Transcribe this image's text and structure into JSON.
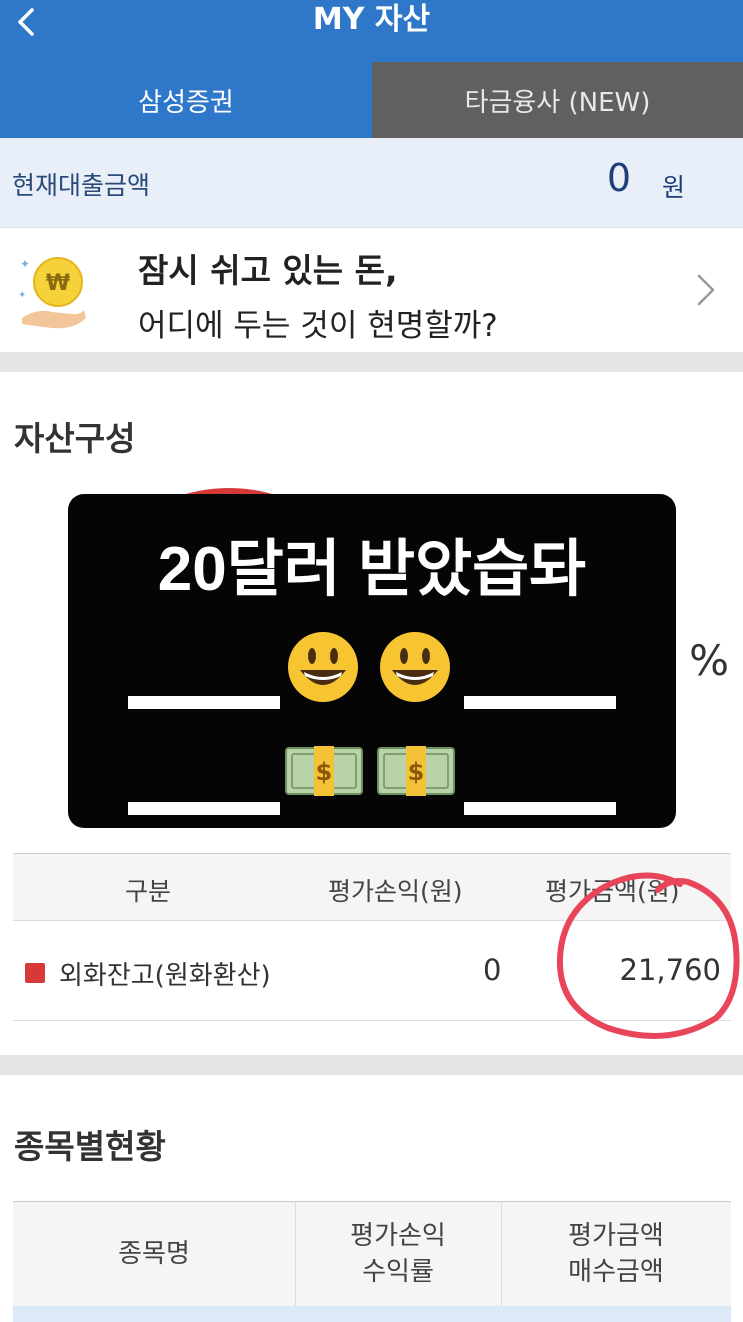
{
  "header": {
    "title": "MY 자산",
    "back_icon": "chevron-left-icon"
  },
  "tabs": [
    {
      "label": "삼성증권",
      "active": true
    },
    {
      "label": "타금융사 (NEW)",
      "active": false
    }
  ],
  "loan": {
    "label": "현재대출금액",
    "value": "0",
    "unit": "원"
  },
  "promo": {
    "line1": "잠시 쉬고 있는 돈,",
    "line2": "어디에 두는 것이 현명할까?",
    "icon": "coin-won-icon"
  },
  "asset_section": {
    "title": "자산구성",
    "percent_suffix": "%",
    "pie_color": "#d63a38"
  },
  "overlay": {
    "text": "20달러 받았습돠"
  },
  "asset_table": {
    "headers": [
      "구분",
      "평가손익(원)",
      "평가금액(원)"
    ],
    "rows": [
      {
        "name": "외화잔고(원화환산)",
        "profit": "0",
        "amount": "21,760",
        "color": "#d63a38"
      }
    ]
  },
  "holdings_section": {
    "title": "종목별현황",
    "headers": [
      {
        "line1": "종목명",
        "line2": ""
      },
      {
        "line1": "평가손익",
        "line2": "수익률"
      },
      {
        "line1": "평가금액",
        "line2": "매수금액"
      }
    ]
  },
  "colors": {
    "primary": "#2f78c9",
    "inactive_tab": "#606060",
    "accent_red": "#d63a38",
    "annotation_pink": "#e8455a"
  }
}
